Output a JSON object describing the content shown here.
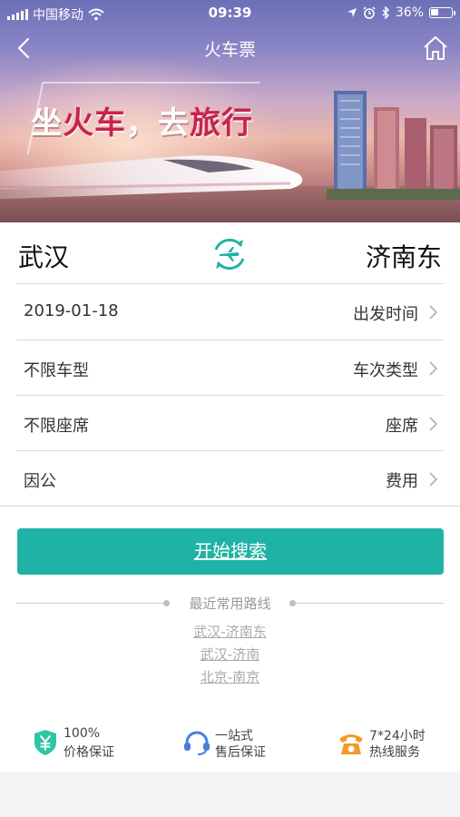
{
  "status_bar": {
    "carrier": "中国移动",
    "time": "09:39",
    "battery_text": "36%",
    "battery_level": 0.36
  },
  "nav": {
    "title": "火车票",
    "back_icon": "chevron-left-icon",
    "home_icon": "home-icon"
  },
  "banner": {
    "slogan_part1": "坐",
    "slogan_part2": "火车",
    "slogan_part3": "，",
    "slogan_part4": "去",
    "slogan_part5": "旅行"
  },
  "route": {
    "from": "武汉",
    "to": "济南东",
    "swap_icon": "train-swap-icon"
  },
  "rows": [
    {
      "label": "2019-01-18",
      "value": "出发时间"
    },
    {
      "label": "不限车型",
      "value": "车次类型"
    },
    {
      "label": "不限座席",
      "value": "座席"
    },
    {
      "label": "因公",
      "value": "费用"
    }
  ],
  "search": {
    "button_label": "开始搜索"
  },
  "recent": {
    "heading": "最近常用路线",
    "routes": [
      "武汉-济南东",
      "武汉-济南",
      "北京-南京"
    ]
  },
  "features": [
    {
      "line1": "100%",
      "line2": "价格保证",
      "icon": "yuan-shield-icon"
    },
    {
      "line1": "一站式",
      "line2": "售后保证",
      "icon": "headset-icon"
    },
    {
      "line1": "7*24小时",
      "line2": "热线服务",
      "icon": "telephone-icon"
    }
  ],
  "colors": {
    "accent": "#1fb3a6",
    "shield": "#2ec4a5",
    "headset": "#4a7fd9",
    "phone": "#f09a2a"
  }
}
